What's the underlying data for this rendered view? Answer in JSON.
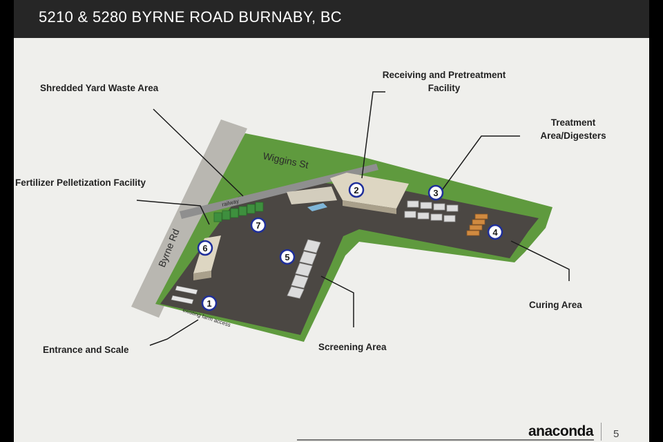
{
  "title": "5210 & 5280 BYRNE ROAD BURNABY, BC",
  "streets": {
    "wiggins": "Wiggins St",
    "byrne": "Byrne Rd",
    "railway": "railway",
    "farm_access": "existing farm access"
  },
  "labels": {
    "shredded_yard_waste": "Shredded Yard Waste Area",
    "receiving_line1": "Receiving and Pretreatment",
    "receiving_line2": "Facility",
    "treatment_line1": "Treatment",
    "treatment_line2": "Area/Digesters",
    "fertilizer": "Fertilizer Pelletization Facility",
    "curing": "Curing Area",
    "entrance": "Entrance and Scale",
    "screening": "Screening Area"
  },
  "markers": [
    "1",
    "2",
    "3",
    "4",
    "5",
    "6",
    "7"
  ],
  "footer": {
    "logo": "anaconda",
    "page": "5"
  },
  "colors": {
    "title_bar": "#262626",
    "grass": "#5f9a3e",
    "pavement": "#4b4743",
    "marker_ring": "#1f2f9a"
  }
}
